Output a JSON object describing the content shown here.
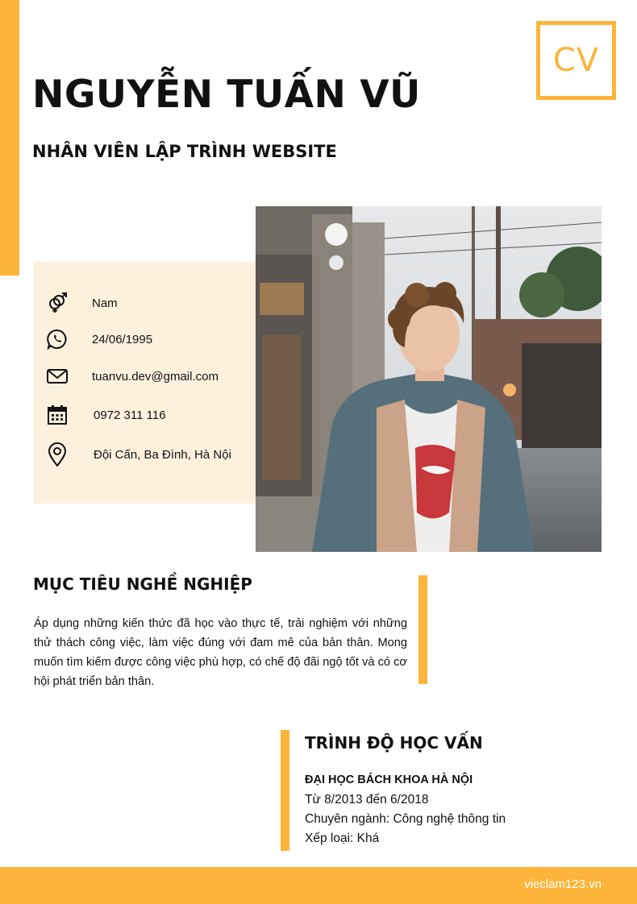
{
  "header": {
    "badge": "CV",
    "name": "NGUYỄN TUẤN VŨ",
    "job_title": "NHÂN VIÊN LẬP TRÌNH WEBSITE"
  },
  "contact": {
    "gender": {
      "icon": "gender-icon",
      "value": "Nam"
    },
    "birthday": {
      "icon": "whatsapp-icon",
      "value": "24/06/1995"
    },
    "email": {
      "icon": "envelope-icon",
      "value": "tuanvu.dev@gmail.com"
    },
    "phone": {
      "icon": "calendar-icon",
      "value": "0972 311 116"
    },
    "address": {
      "icon": "location-pin-icon",
      "value": "Đội Cấn, Ba Đình, Hà Nội"
    }
  },
  "career_goal": {
    "title": "MỤC TIÊU NGHỀ NGHIỆP",
    "text": "Áp dụng những kiến thức đã học vào thực tế, trải nghiệm với những thử thách công việc, làm việc đúng với đam mê của bản thân. Mong muốn tìm kiếm được công việc phù hợp, có chế độ đãi ngộ tốt và có cơ hội phát triển bản thân."
  },
  "education": {
    "title": "TRÌNH ĐỘ HỌC VẤN",
    "school": "ĐẠI HỌC BÁCH KHOA HÀ NỘI",
    "period": "Từ 8/2013 đến 6/2018",
    "major": "Chuyên ngành: Công nghệ thông tin",
    "rank": "Xếp loại: Khá"
  },
  "footer": {
    "brand": "vieclam123.vn"
  },
  "colors": {
    "accent": "#fcb53a",
    "info_bg": "#fdf1de",
    "text": "#111111"
  }
}
